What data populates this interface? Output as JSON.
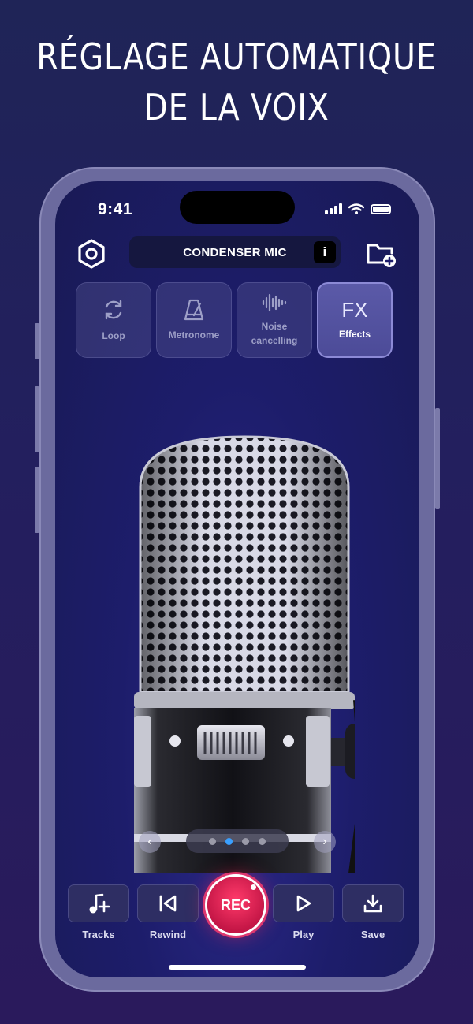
{
  "headline": {
    "line1": "RÉGLAGE AUTOMATIQUE",
    "line2": "DE LA VOIX"
  },
  "status": {
    "time": "9:41",
    "icons": [
      "signal-icon",
      "wifi-icon",
      "battery-icon"
    ]
  },
  "header": {
    "mic_title": "CONDENSER MIC",
    "info_label": "i",
    "settings_icon": "hexagon-settings-icon",
    "folder_icon": "folder-add-icon"
  },
  "modes": [
    {
      "id": "loop",
      "label": "Loop",
      "icon": "loop-icon",
      "active": false
    },
    {
      "id": "metronome",
      "label": "Metronome",
      "icon": "metronome-icon",
      "active": false
    },
    {
      "id": "noise",
      "label": "Noise cancelling",
      "icon": "waveform-icon",
      "active": false
    },
    {
      "id": "effects",
      "label": "Effects",
      "icon_text": "FX",
      "active": true
    }
  ],
  "carousel": {
    "pages": 4,
    "active_index": 1
  },
  "toolbar": {
    "tracks_label": "Tracks",
    "rewind_label": "Rewind",
    "rec_label": "REC",
    "play_label": "Play",
    "save_label": "Save"
  },
  "colors": {
    "accent": "#3aa0ff",
    "rec": "#e0245a",
    "background": "#1d1d6b"
  }
}
